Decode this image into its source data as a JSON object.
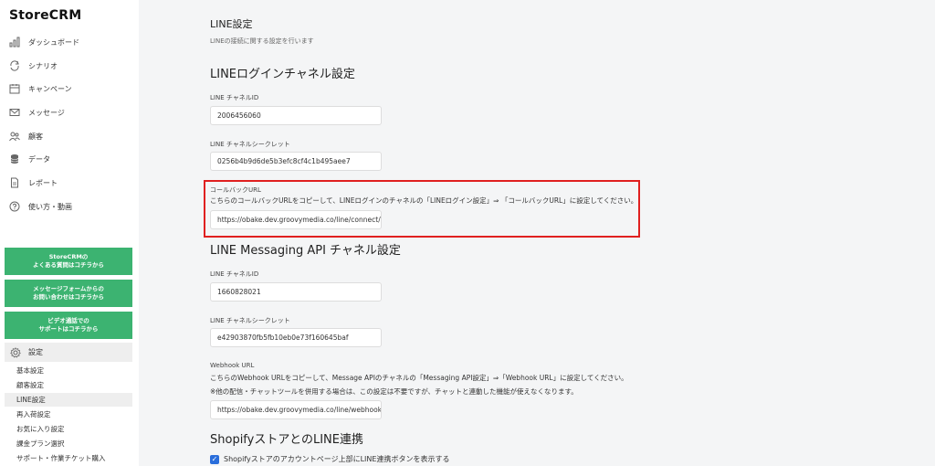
{
  "app": {
    "logo": "StoreCRM"
  },
  "sidebar": {
    "items": [
      {
        "label": "ダッシュボード",
        "icon": "bar-chart-icon"
      },
      {
        "label": "シナリオ",
        "icon": "loop-icon"
      },
      {
        "label": "キャンペーン",
        "icon": "calendar-icon"
      },
      {
        "label": "メッセージ",
        "icon": "mail-icon"
      },
      {
        "label": "顧客",
        "icon": "users-icon"
      },
      {
        "label": "データ",
        "icon": "database-icon"
      },
      {
        "label": "レポート",
        "icon": "report-icon"
      },
      {
        "label": "使い方・動画",
        "icon": "help-icon"
      }
    ],
    "help_buttons": [
      {
        "line1": "StoreCRMの",
        "line2": "よくある質問はコチラから"
      },
      {
        "line1": "メッセージフォームからの",
        "line2": "お問い合わせはコチラから"
      },
      {
        "line1": "ビデオ通話での",
        "line2": "サポートはコチラから"
      }
    ],
    "settings": {
      "label": "設定",
      "icon": "gear-icon",
      "subitems": [
        "基本設定",
        "顧客設定",
        "LINE設定",
        "再入荷設定",
        "お気に入り設定",
        "課金プラン選択",
        "サポート・作業チケット購入"
      ],
      "active": "LINE設定"
    }
  },
  "page": {
    "title": "LINE設定",
    "subtitle": "LINEの接続に関する設定を行います"
  },
  "login_channel": {
    "heading": "LINEログインチャネル設定",
    "channel_id_label": "LINE チャネルID",
    "channel_id": "2006456060",
    "secret_label": "LINE チャネルシークレット",
    "secret": "0256b4b9d6de5b3efc8cf4c1b495aee7",
    "callback_label": "コールバックURL",
    "callback_desc": "こちらのコールバックURLをコピーして、LINEログインのチャネルの「LINEログイン設定」⇒ 「コールバックURL」に設定してください。",
    "callback_url": "https://obake.dev.groovymedia.co/line/connect/"
  },
  "messaging_channel": {
    "heading": "LINE Messaging API チャネル設定",
    "channel_id_label": "LINE チャネルID",
    "channel_id": "1660828021",
    "secret_label": "LINE チャネルシークレット",
    "secret": "e42903870fb5fb10eb0e73f160645baf",
    "webhook_label": "Webhook URL",
    "webhook_desc1": "こちらのWebhook URLをコピーして、Message APIのチャネルの「Messaging API設定」⇒「Webhook URL」に設定してください。",
    "webhook_desc2": "※他の配信・チャットツールを併用する場合は、この設定は不要ですが、チャットと連動した機能が使えなくなります。",
    "webhook_url": "https://obake.dev.groovymedia.co/line/webhook/"
  },
  "shopify": {
    "heading": "ShopifyストアとのLINE連携",
    "checkbox_label": "Shopifyストアのアカウントページ上部にLINE連携ボタンを表示する",
    "checked": true
  },
  "colors": {
    "accent_green": "#3cb371",
    "highlight_red": "#e02020",
    "checkbox_blue": "#2a6edb"
  }
}
